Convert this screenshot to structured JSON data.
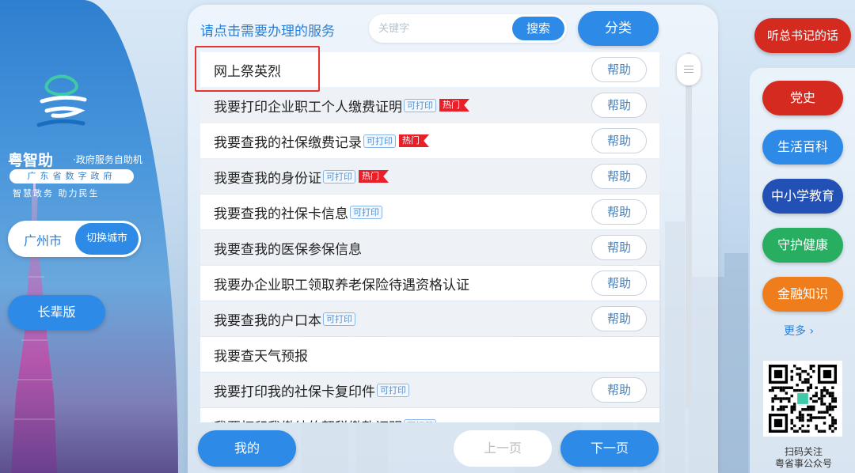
{
  "left_panel": {
    "brand_title": "粤智助",
    "brand_sub": "·政府服务自助机",
    "brand_org": "广东省数字政府",
    "brand_slogan": "智慧政务  助力民生",
    "city": "广州市",
    "switch_city_label": "切换城市",
    "elder_mode_label": "长辈版"
  },
  "header": {
    "prompt": "请点击需要办理的服务",
    "search_placeholder": "关键字",
    "search_label": "搜索",
    "category_label": "分类"
  },
  "services": [
    {
      "label": "网上祭英烈",
      "printable": false,
      "hot": false,
      "help": true
    },
    {
      "label": "我要打印企业职工个人缴费证明",
      "printable": true,
      "hot": true,
      "help": true
    },
    {
      "label": "我要查我的社保缴费记录",
      "printable": true,
      "hot": true,
      "help": true
    },
    {
      "label": "我要查我的身份证",
      "printable": true,
      "hot": true,
      "help": true
    },
    {
      "label": "我要查我的社保卡信息",
      "printable": true,
      "hot": false,
      "help": true
    },
    {
      "label": "我要查我的医保参保信息",
      "printable": false,
      "hot": false,
      "help": true
    },
    {
      "label": "我要办企业职工领取养老保险待遇资格认证",
      "printable": false,
      "hot": false,
      "help": true
    },
    {
      "label": "我要查我的户口本",
      "printable": true,
      "hot": false,
      "help": true
    },
    {
      "label": "我要查天气预报",
      "printable": false,
      "hot": false,
      "help": false
    },
    {
      "label": "我要打印我的社保卡复印件",
      "printable": true,
      "hot": false,
      "help": true
    },
    {
      "label": "我要打印我缴纳的契税缴款证明",
      "printable": true,
      "hot": false,
      "help": false
    }
  ],
  "tags": {
    "printable": "可打印",
    "hot": "热门",
    "help": "帮助"
  },
  "footer": {
    "mine_label": "我的",
    "prev_label": "上一页",
    "next_label": "下一页"
  },
  "right_panel": {
    "speech_label": "听总书记的话",
    "buttons": [
      {
        "label": "党史",
        "color": "#d42a20"
      },
      {
        "label": "生活百科",
        "color": "#2d8ae6"
      },
      {
        "label": "中小学教育",
        "color": "#2350b5"
      },
      {
        "label": "守护健康",
        "color": "#27ae60"
      },
      {
        "label": "金融知识",
        "color": "#f07d1c"
      }
    ],
    "more_label": "更多",
    "qr_caption_line1": "扫码关注",
    "qr_caption_line2": "粤省事公众号"
  },
  "colors": {
    "accent": "#2d8ae6",
    "hot_tag": "#e8202a",
    "highlight_border": "#e8322e"
  }
}
